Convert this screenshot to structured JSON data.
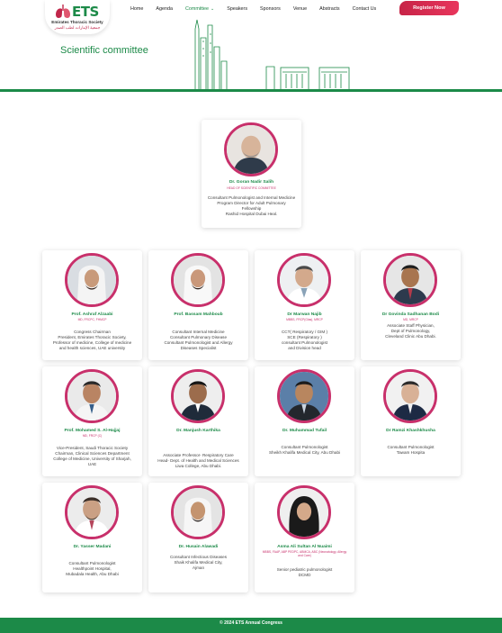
{
  "logo": {
    "mark": "ETS",
    "name": "Emirates Thoracic Society",
    "arabic": "جمعية الإمارات لطب الصدر"
  },
  "nav": {
    "items": [
      "Home",
      "Agenda",
      "Committee",
      "Speakers",
      "Sponsors",
      "Venue",
      "Abstracts",
      "Contact Us"
    ],
    "active": "Committee"
  },
  "register_label": "Register Now",
  "page_title": "Scientific committee",
  "head": {
    "name": "Dr. Goran Nadir Salih",
    "role": "HEAD OF SCIENTIFIC COMMITTEE",
    "bio": "Consultant Pulmonologist and Internal Medicine\nProgram Director for Adult Pulmonary\nFellowship\nRashid Hospital Dubai Heal."
  },
  "members": [
    {
      "name": "Prof. Ashraf Alzaabi",
      "creds": "MD, FRCPC, FHMCP",
      "bio": "Congress Chairman\nPresident, Emirates Thoracic Society,\nProfessor of medicine, College of medicine\nand health sciences, UAE university"
    },
    {
      "name": "Prof. Bassam Mahboub",
      "creds": "",
      "bio": "Consultant Internal Medicine\nConsultant Pulmonary Disease\nConsultant Pulmonologist and Allergy\nDiseases Specialist"
    },
    {
      "name": "Dr Marwan Najib",
      "creds": "MBBS, FRCP(Glas), MRCP",
      "bio": "CCT( Respiratory / GIM )\nSCE (Respiratory )\nconsultant Pulmonologist\nand Division head"
    },
    {
      "name": "Dr Govinda Sadhanan Bodi",
      "creds": "MD, MRCP",
      "bio": "Associate Staff Physician,\nDept of Pulmonology,\nCleveland Clinic Abu Dhabi."
    },
    {
      "name": "Prof. Mohamed S. Al-Hajjaj",
      "creds": "MD, FRCP (C)",
      "bio": "Vice-President, Saudi Thoracic Society\nChairman, Clinical Sciences Department\nCollege of Medicine, University of Sharjah,\nUAE"
    },
    {
      "name": "Dr. Manjush Karthika",
      "creds": "",
      "bio": "Associate Professor- Respiratory Care\nHead- Dept. of Health and Medical Sciences\nLiwa College, Abu Dhabi."
    },
    {
      "name": "Dr. Muhammad Tufail",
      "creds": "",
      "bio": "Consultant Pulmonologist\nSheikh Khalifa Medical City, Abu Dhabi"
    },
    {
      "name": "Dr Ramzi Khashkhusha",
      "creds": "",
      "bio": "Consultant Pulmonologist\nTawam Hospita"
    },
    {
      "name": "Dr. Yasser Madani",
      "creds": "",
      "bio": "Consultant Pulmonologist\nHealthpoint Hospital,\nMubadala Health, Abu Dhabi"
    },
    {
      "name": "Dr. Husain Alawadi",
      "creds": "",
      "bio": "Consultant Infectious Diseases\nShaik Khalifa Medical City,\nAjman"
    },
    {
      "name": "Asma Ali Sultan Al Nuaimi",
      "creds": "MBBS, FAAP, ABP PEDPC, ABMCA, ABC (Neonatology, Allergy and Care)",
      "bio": "Senior pediatric pulmonologist\nDCMD"
    }
  ],
  "footer_text": "© 2024 ETS Annual Congress",
  "colors": {
    "brand_green": "#1c8a48",
    "accent_pink": "#c8306b",
    "register_red": "#d32a50"
  }
}
